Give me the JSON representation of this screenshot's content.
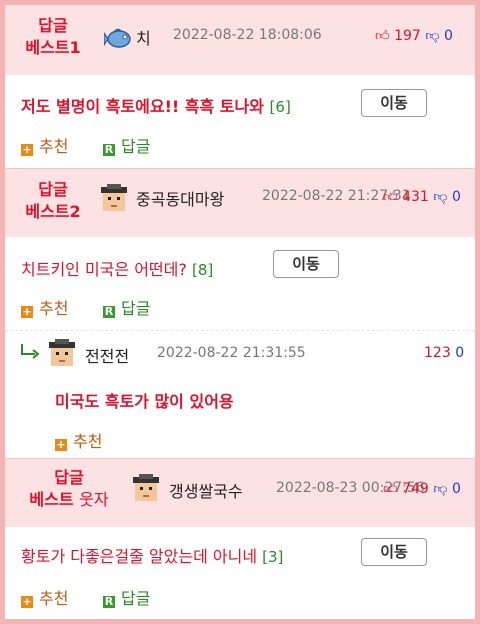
{
  "posts": [
    {
      "rank_line1": "답글",
      "rank_line2": "베스트1",
      "rank_sub": "",
      "avatar_icon": "fish-icon",
      "nickname": "치",
      "date": "2022-08-22 18:08:06",
      "upvotes": "197",
      "downvotes": "0",
      "comment": "저도 별명이 흑토에요!! 흑흑 토나와",
      "reply_count": "[6]",
      "move_label": "이동",
      "recommend_label": "추천",
      "reply_label": "답글"
    },
    {
      "rank_line1": "답글",
      "rank_line2": "베스트2",
      "rank_sub": "",
      "avatar_icon": "pixel-face-icon",
      "nickname": "중곡동대마왕",
      "date": "2022-08-22 21:27:31",
      "upvotes": "431",
      "downvotes": "0",
      "comment": "치트키인 미국은 어떤데?",
      "reply_count": "[8]",
      "move_label": "이동",
      "recommend_label": "추천",
      "reply_label": "답글"
    },
    {
      "rank_line1": "답글",
      "rank_line2": "베스트",
      "rank_sub": "웃자",
      "avatar_icon": "pixel-face-icon",
      "nickname": "갱생쌀국수",
      "date": "2022-08-23 00:27:56",
      "upvotes": "749",
      "downvotes": "0",
      "comment": "황토가 다좋은걸줄 알았는데 아니네",
      "reply_count": "[3]",
      "move_label": "이동",
      "recommend_label": "추천",
      "reply_label": "답글"
    }
  ],
  "reply": {
    "arrow_icon": "reply-arrow-icon",
    "avatar_icon": "pixel-face-icon",
    "nickname": "전전전",
    "date": "2022-08-22 21:31:55",
    "upvotes": "123",
    "downvotes": "0",
    "comment": "미국도 흑토가 많이 있어용",
    "recommend_label": "추천"
  },
  "colors": {
    "accent_red": "#e0122b",
    "down_blue": "#1a3ccf",
    "header_pink": "#fde2e4",
    "border_pink": "#f5b3b3",
    "count_green": "#2a8a2a",
    "recommend_orange": "#e98a12"
  },
  "icons": {
    "thumbs_up": "thumbs-up-icon",
    "thumbs_down": "thumbs-down-icon",
    "plus": "plus-icon",
    "reply_r": "reply-r-icon"
  }
}
